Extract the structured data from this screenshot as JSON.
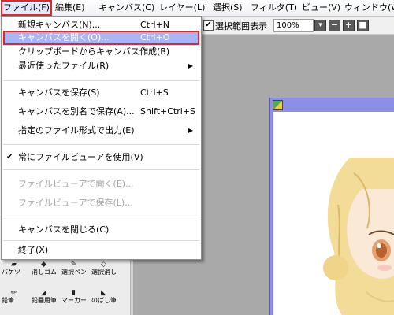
{
  "menubar": {
    "items": [
      {
        "label": "ファイル(F)"
      },
      {
        "label": "編集(E)"
      },
      {
        "label": "キャンバス(C)"
      },
      {
        "label": "レイヤー(L)"
      },
      {
        "label": "選択(S)"
      },
      {
        "label": "フィルタ(T)"
      },
      {
        "label": "ビュー(V)"
      },
      {
        "label": "ウィンドウ(W)"
      }
    ]
  },
  "toolbar": {
    "selection_checkbox_label": "選択範囲表示",
    "selection_checked": true,
    "zoom_value": "100%"
  },
  "file_menu": {
    "new_canvas": {
      "label": "新規キャンバス(N)...",
      "shortcut": "Ctrl+N"
    },
    "open_canvas": {
      "label": "キャンバスを開く(O)...",
      "shortcut": "Ctrl+O"
    },
    "from_clipboard": {
      "label": "クリップボードからキャンバス作成(B)"
    },
    "recent_files": {
      "label": "最近使ったファイル(R)"
    },
    "save_canvas": {
      "label": "キャンバスを保存(S)",
      "shortcut": "Ctrl+S"
    },
    "save_as": {
      "label": "キャンバスを別名で保存(A)...",
      "shortcut": "Shift+Ctrl+S"
    },
    "export_format": {
      "label": "指定のファイル形式で出力(E)"
    },
    "use_file_viewer": {
      "label": "常にファイルビューアを使用(V)",
      "checked": true
    },
    "open_in_viewer": {
      "label": "ファイルビューアで開く(E)..."
    },
    "save_in_viewer": {
      "label": "ファイルビューアで保存(L)..."
    },
    "close_canvas": {
      "label": "キャンバスを閉じる(C)"
    },
    "exit": {
      "label": "終了(X)"
    }
  },
  "tools": {
    "row1": [
      "バケツ",
      "消しゴム",
      "選択ペン",
      "選択消し"
    ],
    "row2": [
      "鉛筆",
      "鉛画用筆",
      "マーカー",
      "のばし筆"
    ]
  },
  "colors": {
    "menu_highlight": "#a9b4f5",
    "annotation_red": "#e0262e",
    "canvas_frame": "#8c8fe6"
  }
}
